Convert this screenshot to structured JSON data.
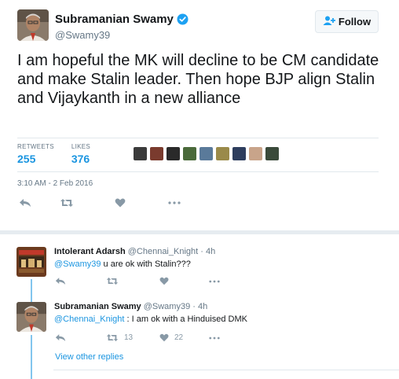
{
  "main_tweet": {
    "author_name": "Subramanian Swamy",
    "author_handle": "@Swamy39",
    "follow_label": "Follow",
    "text": "I am hopeful the MK will decline to be CM candidate and make Stalin leader. Then hope BJP align Stalin and Vijaykanth in a new alliance",
    "retweets_label": "RETWEETS",
    "retweets_count": "255",
    "likes_label": "LIKES",
    "likes_count": "376",
    "timestamp": "3:10 AM - 2 Feb 2016"
  },
  "replies": [
    {
      "name": "Intolerant Adarsh",
      "handle": "@Chennai_Knight",
      "age": "4h",
      "mention": "@Swamy39",
      "text": " u are ok with Stalin???"
    },
    {
      "name": "Subramanian Swamy",
      "handle": "@Swamy39",
      "age": "4h",
      "mention": "@Chennai_Knight",
      "text": " : I am ok with a Hinduised DMK",
      "retweets": "13",
      "likes": "22"
    }
  ],
  "view_other_replies": "View other replies",
  "colors": {
    "accent": "#1b95e0",
    "text": "#14171a",
    "muted": "#657786",
    "icon": "#8899a6",
    "border": "#e1e8ed"
  },
  "icons": [
    "verified-badge-icon",
    "add-user-icon",
    "reply-icon",
    "retweet-icon",
    "heart-icon",
    "more-icon"
  ]
}
